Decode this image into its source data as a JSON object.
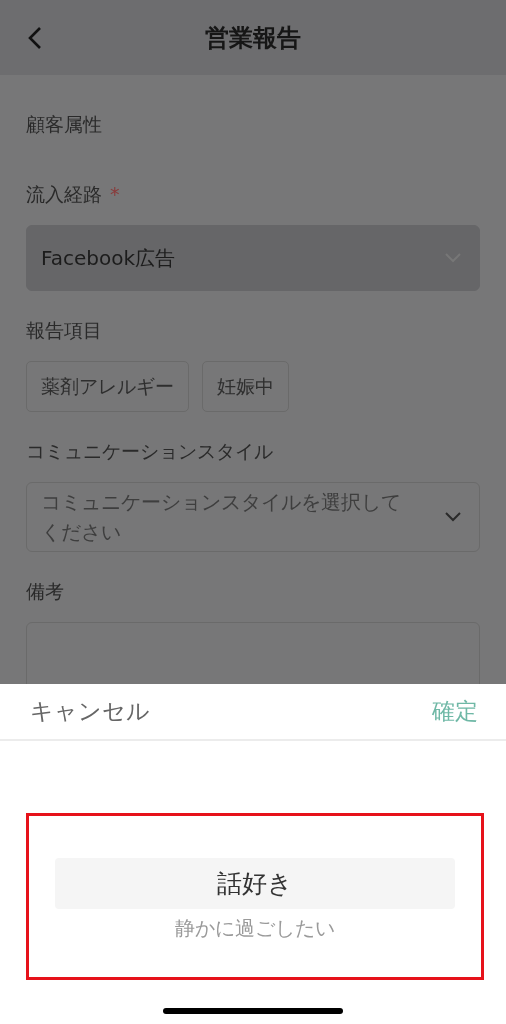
{
  "header": {
    "title": "営業報告"
  },
  "form": {
    "fields": [
      {
        "kind": "label",
        "label": "顧客属性"
      },
      {
        "kind": "select",
        "label": "流入経路",
        "required_mark": "*",
        "value": "Facebook広告"
      },
      {
        "kind": "chips",
        "label": "報告項目",
        "chips": [
          "薬剤アレルギー",
          "妊娠中"
        ]
      },
      {
        "kind": "select",
        "label": "コミュニケーションスタイル",
        "placeholder": "コミュニケーションスタイルを選択してください"
      },
      {
        "kind": "textarea",
        "label": "備考"
      }
    ]
  },
  "picker": {
    "cancel": "キャンセル",
    "confirm": "確定",
    "options": [
      {
        "label": "話好き",
        "selected": true
      },
      {
        "label": "静かに過ごしたい",
        "selected": false
      }
    ]
  }
}
